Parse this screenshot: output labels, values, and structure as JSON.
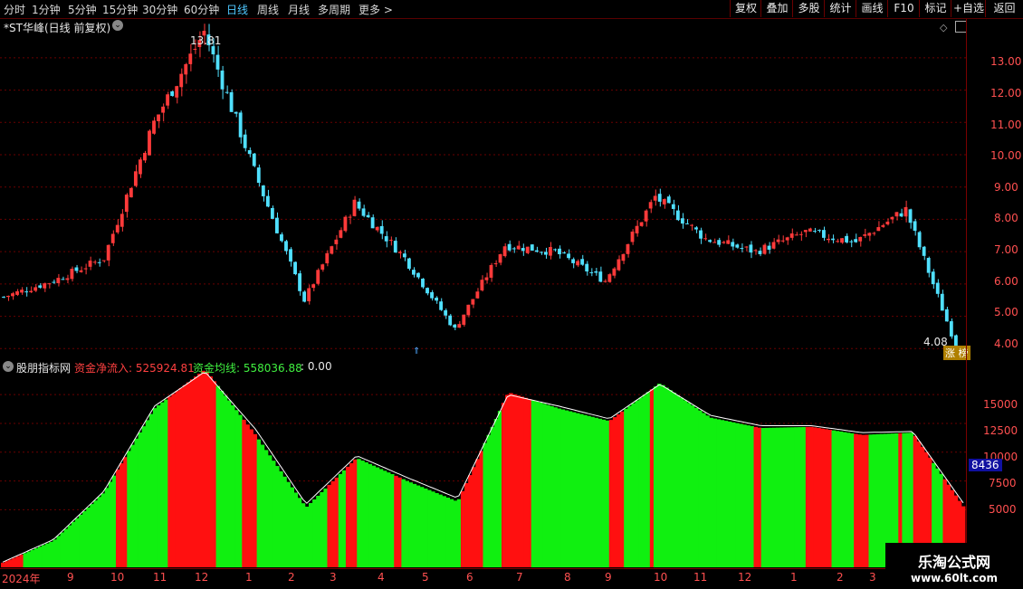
{
  "toolbar": {
    "periods": [
      "分时",
      "1分钟",
      "5分钟",
      "15分钟",
      "30分钟",
      "60分钟",
      "日线",
      "周线",
      "月线",
      "多周期",
      "更多"
    ],
    "active_period": "日线",
    "right_buttons": [
      "复权",
      "叠加",
      "多股",
      "统计",
      "画线",
      "F10",
      "标记",
      "+自选",
      "返回"
    ]
  },
  "price_panel": {
    "title": "*ST华峰(日线 前复权)",
    "high_label": "13.81",
    "low_label": "4.08",
    "corner_tag": "涨 榜",
    "y_ticks": [
      "13.00",
      "12.00",
      "11.00",
      "10.00",
      "9.00",
      "8.00",
      "7.00",
      "6.00",
      "5.00",
      "4.00"
    ]
  },
  "indicator_panel": {
    "name": "股朋指标网",
    "net_inflow_label": "资金净流入: 525924.81",
    "avg_line_label": "资金均线: 558036.88",
    "extra_label": ": 0.00",
    "y_ticks": [
      "15000",
      "12500",
      "10000",
      "7500",
      "5000"
    ],
    "current_value": "8436"
  },
  "date_axis": [
    "2024年",
    "9",
    "10",
    "11",
    "12",
    "1",
    "2",
    "3",
    "4",
    "5",
    "6",
    "7",
    "8",
    "9",
    "10",
    "11",
    "12",
    "1",
    "2",
    "3"
  ],
  "watermark": {
    "line1": "乐淘公式网",
    "line2": "www.60lt.com"
  },
  "colors": {
    "up": "#ff3a3a",
    "down": "#50e0ff",
    "inflow_red": "#ff1010",
    "inflow_green": "#10f010",
    "grid": "#6a0000"
  },
  "chart_data": [
    {
      "type": "line",
      "title": "*ST华峰(日线 前复权)",
      "ylim": [
        3.7,
        14.2
      ],
      "x": [
        "2024-08",
        "2024-09",
        "2024-10",
        "2024-11",
        "2024-12",
        "2025-01",
        "2025-02",
        "2025-03",
        "2025-04",
        "2025-05",
        "2025-06",
        "2025-07",
        "2025-08",
        "2025-09",
        "2025-10",
        "2025-11",
        "2025-12",
        "2026-01",
        "2026-02",
        "2026-03"
      ],
      "series": [
        {
          "name": "",
          "values": [
            5.6,
            6.1,
            6.8,
            11.0,
            13.81,
            9.5,
            5.5,
            8.5,
            6.8,
            4.6,
            7.2,
            7.0,
            6.1,
            8.7,
            7.4,
            7.0,
            7.6,
            7.3,
            8.3,
            4.08
          ]
        }
      ],
      "annotations": [
        "13.81",
        "4.08"
      ]
    },
    {
      "type": "area",
      "title": "股朋指标网",
      "ylim": [
        0,
        18000
      ],
      "x": [
        "2024-08",
        "2024-09",
        "2024-10",
        "2024-11",
        "2024-12",
        "2025-01",
        "2025-02",
        "2025-03",
        "2025-04",
        "2025-05",
        "2025-06",
        "2025-07",
        "2025-08",
        "2025-09",
        "2025-10",
        "2025-11",
        "2025-12",
        "2026-01",
        "2026-02",
        "2026-03"
      ],
      "series": [
        {
          "name": "资金净流入",
          "values": [
            400,
            2300,
            6500,
            13800,
            17200,
            11500,
            5200,
            9500,
            7500,
            5700,
            15200,
            13800,
            12700,
            16000,
            13000,
            12100,
            12200,
            11500,
            11700,
            5300
          ]
        },
        {
          "name": "资金均线",
          "values": [
            450,
            2400,
            6600,
            14000,
            17000,
            12000,
            5500,
            9700,
            7800,
            6000,
            15000,
            14000,
            12900,
            15900,
            13200,
            12300,
            12300,
            11700,
            11800,
            5600
          ]
        }
      ]
    }
  ]
}
